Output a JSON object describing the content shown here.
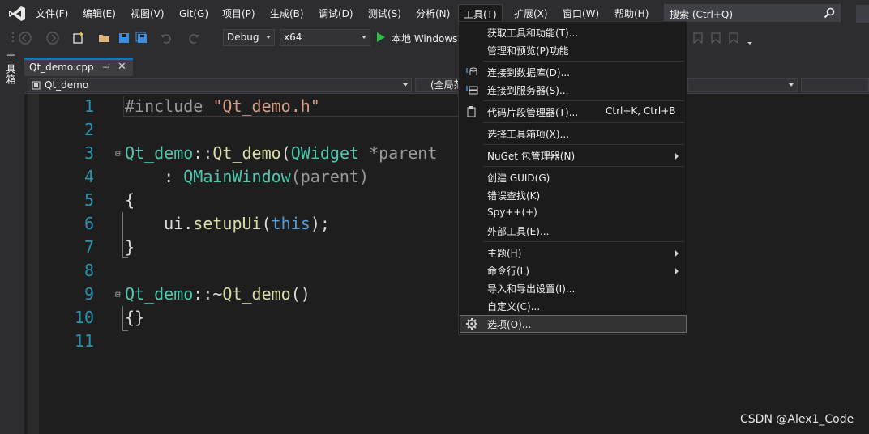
{
  "menubar": {
    "items": [
      "文件(F)",
      "编辑(E)",
      "视图(V)",
      "Git(G)",
      "项目(P)",
      "生成(B)",
      "调试(D)",
      "测试(S)",
      "分析(N)",
      "工具(T)",
      "扩展(X)",
      "窗口(W)",
      "帮助(H)"
    ],
    "search_placeholder": "搜索 (Ctrl+Q)"
  },
  "toolbar": {
    "configuration": "Debug",
    "platform": "x64",
    "run_label": "本地 Windows"
  },
  "left_strip": {
    "toolbox_label": "工具箱"
  },
  "tab": {
    "filename": "Qt_demo.cpp",
    "pin": "⊣",
    "close": "✕"
  },
  "navbar": {
    "project": "Qt_demo",
    "scope": "(全局范围)"
  },
  "editor": {
    "line_numbers": [
      "1",
      "2",
      "3",
      "4",
      "5",
      "6",
      "7",
      "8",
      "9",
      "10",
      "11"
    ],
    "lines": {
      "l1_include": "#include ",
      "l1_header": "\"Qt_demo.h\"",
      "l3_class": "Qt_demo",
      "l3_sep": "::",
      "l3_ctor": "Qt_demo",
      "l3_paren": "(",
      "l3_type": "QWidget",
      "l3_rest": " *parent",
      "l4_colon": "    : ",
      "l4_base": "QMainWindow",
      "l4_args": "(parent)",
      "l5": "{",
      "l6_obj": "    ui.",
      "l6_fn": "setupUi",
      "l6_open": "(",
      "l6_this": "this",
      "l6_close": ");",
      "l7": "}",
      "l9_class": "Qt_demo",
      "l9_sep": "::~",
      "l9_dtor": "Qt_demo",
      "l9_paren": "()",
      "l10": "{}"
    },
    "fold_marker": "⊟"
  },
  "tools_menu": {
    "items": [
      {
        "label": "获取工具和功能(T)..."
      },
      {
        "label": "管理和预览(P)功能"
      },
      {
        "label": "连接到数据库(D)..."
      },
      {
        "label": "连接到服务器(S)..."
      },
      {
        "label": "代码片段管理器(T)...",
        "shortcut": "Ctrl+K, Ctrl+B"
      },
      {
        "label": "选择工具箱项(X)..."
      },
      {
        "label": "NuGet 包管理器(N)"
      },
      {
        "label": "创建 GUID(G)"
      },
      {
        "label": "错误查找(K)"
      },
      {
        "label": "Spy++(+)"
      },
      {
        "label": "外部工具(E)..."
      },
      {
        "label": "主题(H)"
      },
      {
        "label": "命令行(L)"
      },
      {
        "label": "导入和导出设置(I)..."
      },
      {
        "label": "自定义(C)..."
      },
      {
        "label": "选项(O)..."
      }
    ]
  },
  "watermark": "CSDN @Alex1_Code",
  "colors": {
    "accent": "#007acc",
    "line_number": "#2b91af",
    "class_name": "#4ec9b0",
    "function": "#dcdcaa",
    "keyword": "#569cd6",
    "string": "#d69d85"
  }
}
